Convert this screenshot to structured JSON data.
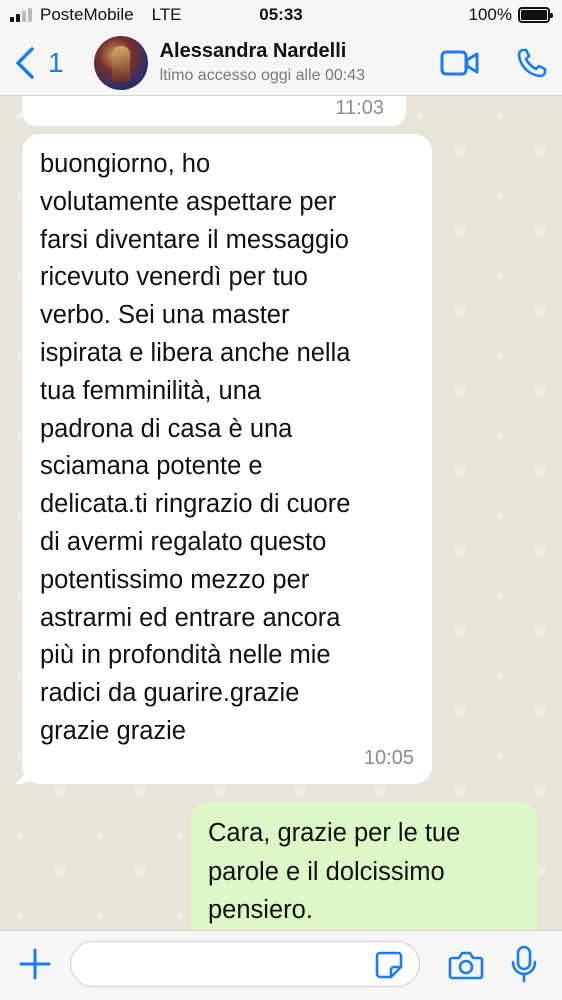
{
  "status_bar": {
    "carrier": "PosteMobile",
    "network": "LTE",
    "time": "05:33",
    "battery": "100%",
    "battery_level": 1.0
  },
  "header": {
    "back_count": "1",
    "contact_name": "Alessandra Nardelli",
    "contact_status": "ltimo accesso oggi alle 00:43",
    "video_icon": "video-camera-icon",
    "call_icon": "phone-icon",
    "accent_color": "#1a7cf2"
  },
  "messages": [
    {
      "direction": "incoming",
      "text": "",
      "time": "11:03"
    },
    {
      "direction": "incoming",
      "text": "buongiorno, ho\nvolutamente aspettare per\nfarsi diventare il messaggio\nricevuto venerdì per tuo\nverbo. Sei una master\nispirata e libera anche nella\ntua femminilità, una\npadrona di casa è una\nsciamana potente e\ndelicata.ti ringrazio di cuore\ndi avermi regalato questo\npotentissimo mezzo per\nastrarmi ed entrare ancora\npiù in profondità nelle mie\nradici da guarire.grazie\ngrazie grazie",
      "time": "10:05"
    },
    {
      "direction": "outgoing",
      "text": "Cara, grazie per le tue\nparole e il dolcissimo\npensiero.",
      "time": ""
    }
  ],
  "input_bar": {
    "placeholder": "",
    "plus_icon": "plus-icon",
    "sticker_icon": "sticker-icon",
    "camera_icon": "camera-icon",
    "mic_icon": "microphone-icon"
  },
  "colors": {
    "outgoing_bubble": "#dcf8c6",
    "incoming_bubble": "#ffffff",
    "chat_background": "#e9e4da"
  }
}
